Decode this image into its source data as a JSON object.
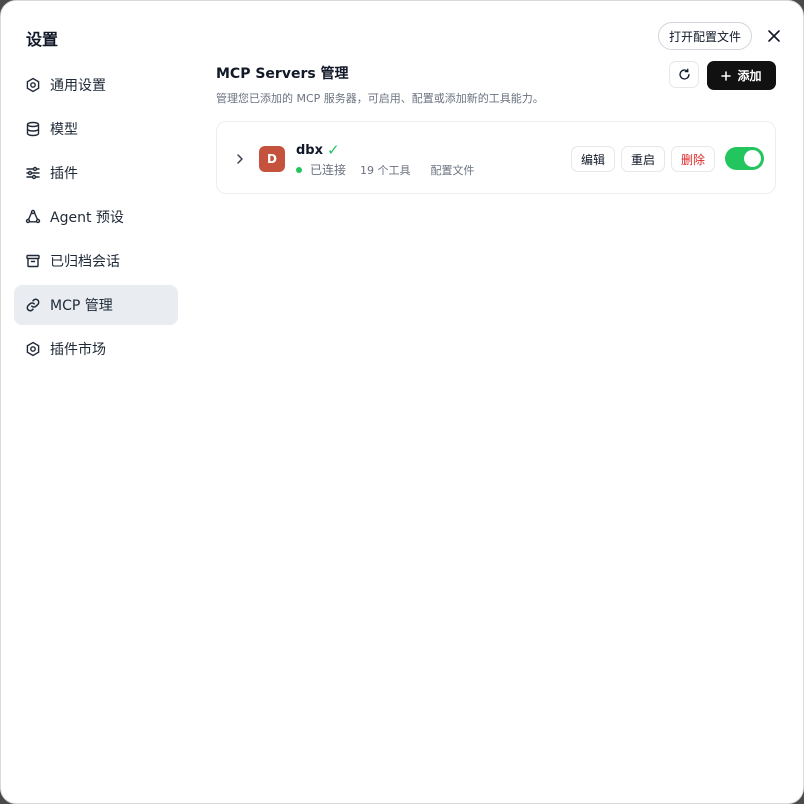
{
  "dialog": {
    "title": "设置",
    "open_config_label": "打开配置文件"
  },
  "sidebar": {
    "items": [
      {
        "label": "通用设置",
        "icon": "gear-icon"
      },
      {
        "label": "模型",
        "icon": "database-icon"
      },
      {
        "label": "插件",
        "icon": "sliders-icon"
      },
      {
        "label": "Agent 预设",
        "icon": "agent-icon"
      },
      {
        "label": "已归档会话",
        "icon": "archive-icon"
      },
      {
        "label": "MCP 管理",
        "icon": "link-icon",
        "active": true
      },
      {
        "label": "插件市场",
        "icon": "gear-icon"
      }
    ]
  },
  "main": {
    "title": "MCP Servers 管理",
    "description": "管理您已添加的 MCP 服务器，可启用、配置或添加新的工具能力。",
    "add_label": "添加"
  },
  "server": {
    "avatar_letter": "D",
    "name": "dbx",
    "check": "✓",
    "status": "已连接",
    "tools": "19 个工具",
    "config": "配置文件",
    "edit_label": "编辑",
    "restart_label": "重启",
    "delete_label": "删除",
    "enabled": true
  },
  "colors": {
    "accent_green": "#22c55e",
    "avatar_bg": "#c4523c",
    "delete_red": "#dc2626",
    "active_nav_bg": "#e9ecf1"
  }
}
